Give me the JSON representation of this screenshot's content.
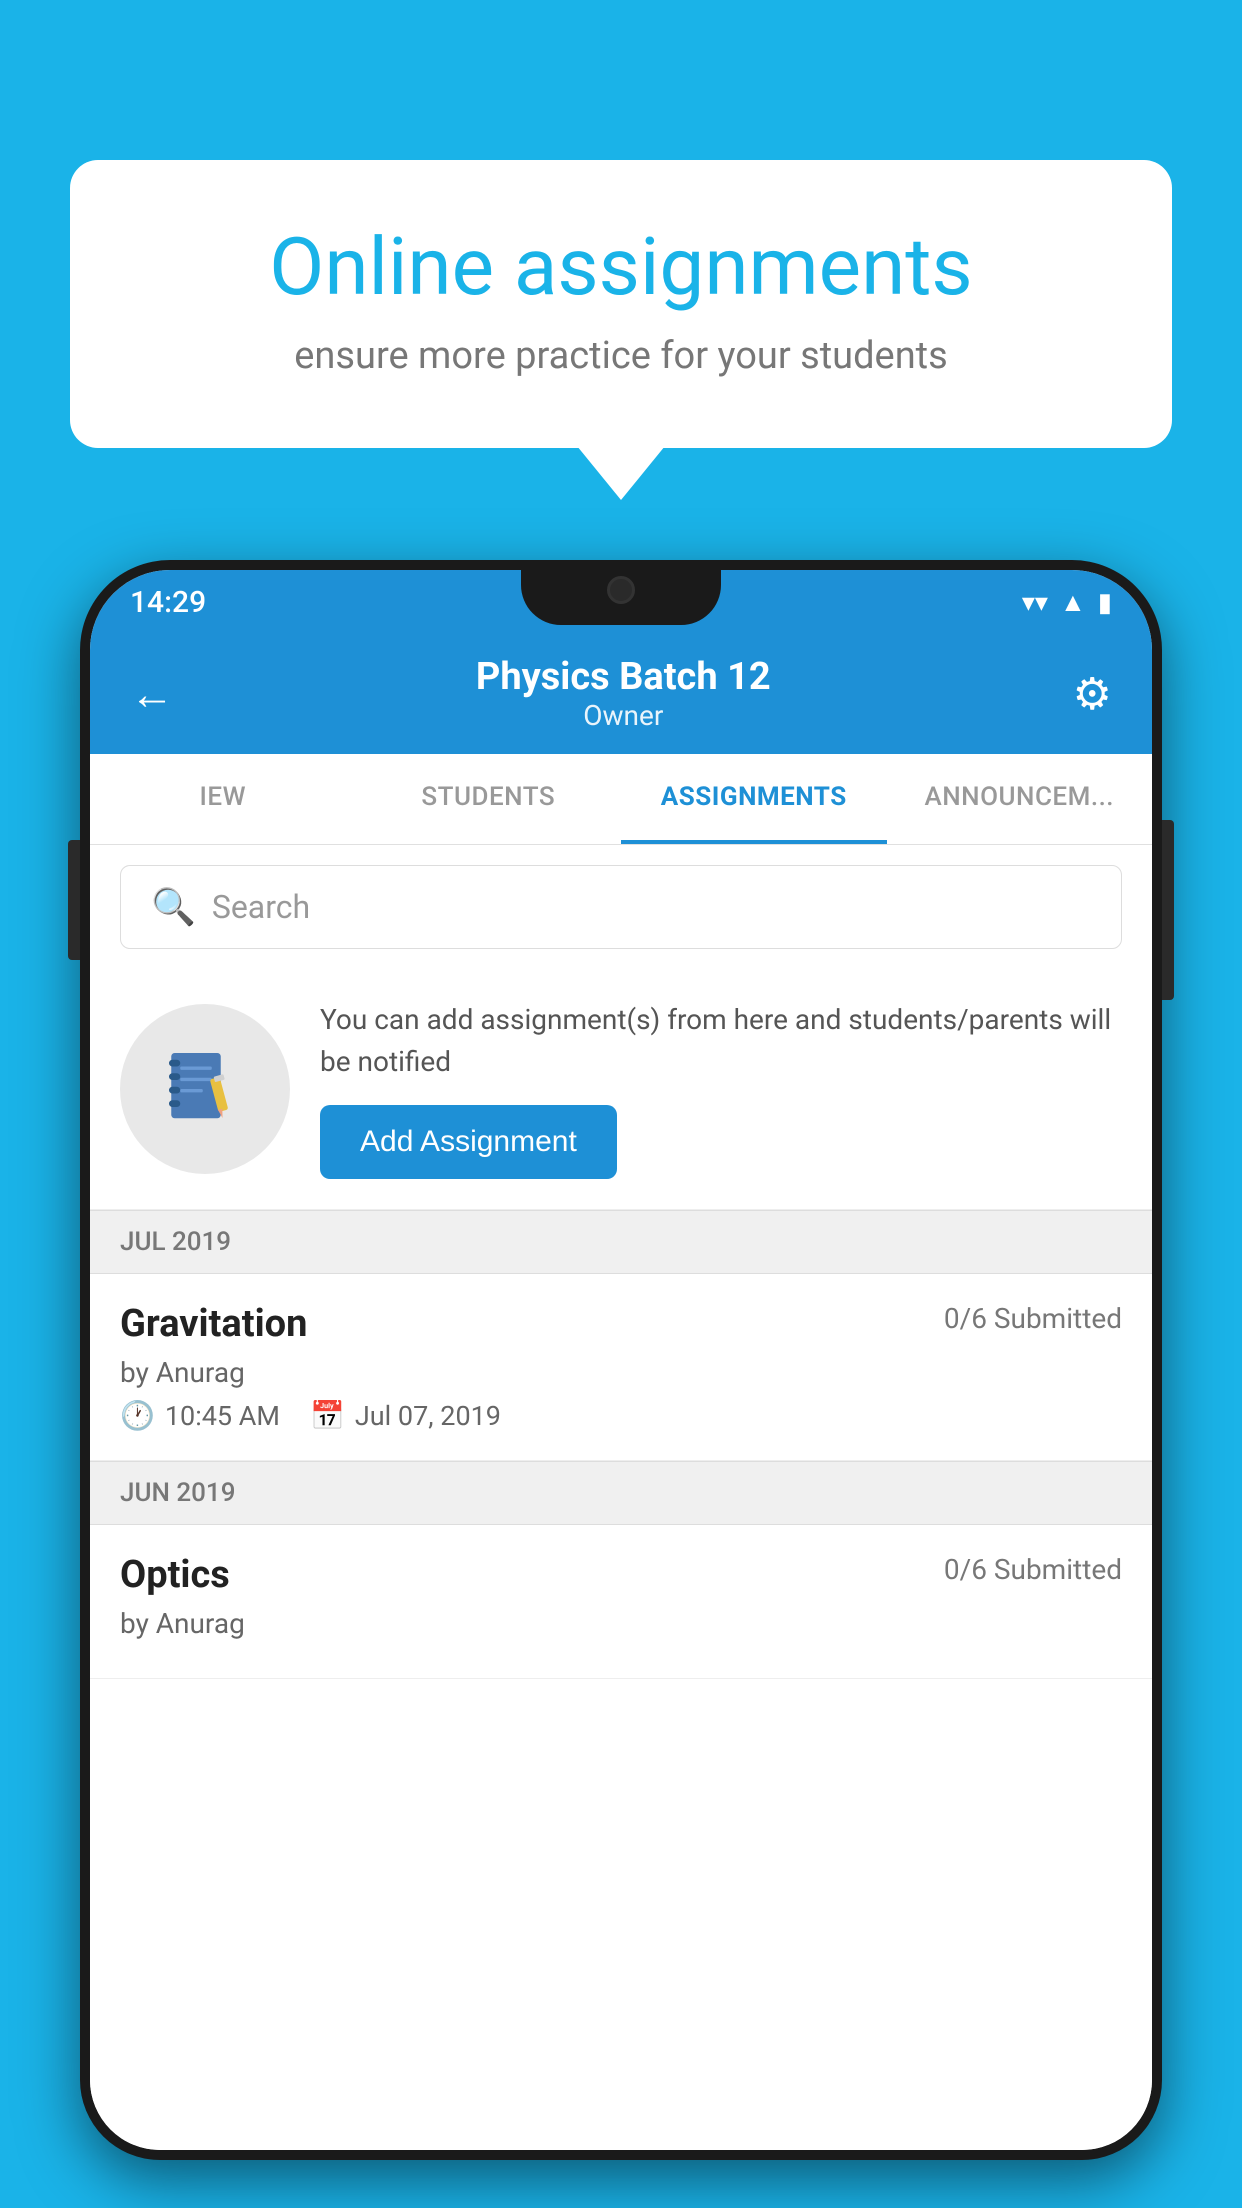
{
  "background_color": "#1ab3e8",
  "speech_bubble": {
    "title": "Online assignments",
    "subtitle": "ensure more practice for your students"
  },
  "phone": {
    "status_bar": {
      "time": "14:29",
      "wifi": "▼",
      "signal": "▲",
      "battery": "▮"
    },
    "header": {
      "title": "Physics Batch 12",
      "subtitle": "Owner",
      "back_label": "←",
      "gear_label": "⚙"
    },
    "tabs": [
      {
        "label": "IEW",
        "active": false
      },
      {
        "label": "STUDENTS",
        "active": false
      },
      {
        "label": "ASSIGNMENTS",
        "active": true
      },
      {
        "label": "ANNOUNCEM...",
        "active": false
      }
    ],
    "search": {
      "placeholder": "Search"
    },
    "add_assignment_banner": {
      "description": "You can add assignment(s) from here and students/parents will be notified",
      "button_label": "Add Assignment"
    },
    "sections": [
      {
        "month": "JUL 2019",
        "assignments": [
          {
            "title": "Gravitation",
            "submitted": "0/6 Submitted",
            "author": "by Anurag",
            "time": "10:45 AM",
            "date": "Jul 07, 2019"
          }
        ]
      },
      {
        "month": "JUN 2019",
        "assignments": [
          {
            "title": "Optics",
            "submitted": "0/6 Submitted",
            "author": "by Anurag",
            "time": "",
            "date": ""
          }
        ]
      }
    ]
  }
}
